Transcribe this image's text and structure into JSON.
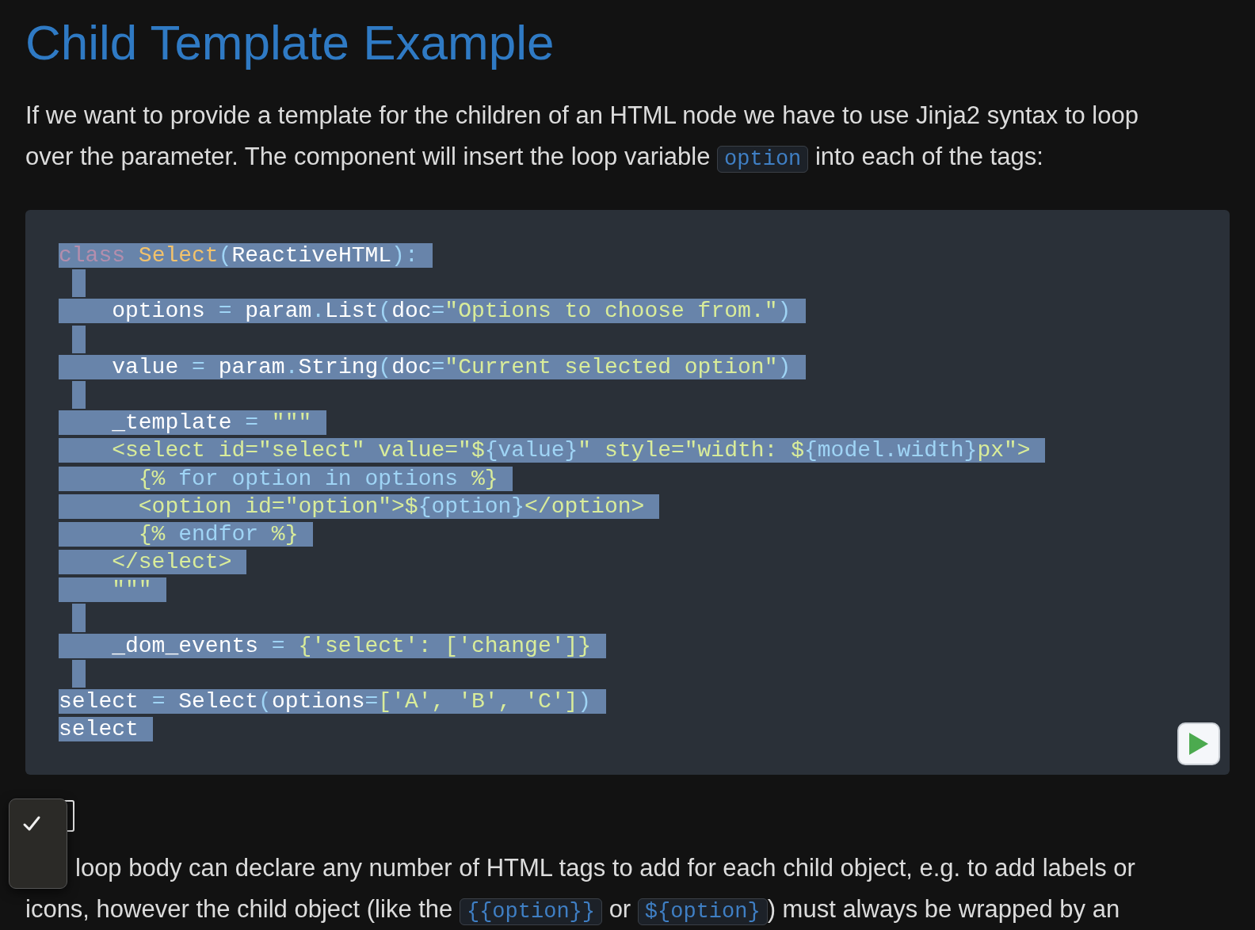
{
  "title": "Child Template Example",
  "intro": {
    "line1": "If we want to provide a template for the children of an HTML node we have to use Jinja2 syntax to loop",
    "before": "over the parameter. The component will insert the loop variable",
    "code": "option",
    "after": "into each of the tags:"
  },
  "code_lines": [
    {
      "kind": "code",
      "tokens": [
        {
          "kind": "keyword",
          "text": "class "
        },
        {
          "kind": "name",
          "text": "Select"
        },
        {
          "kind": "punct",
          "text": "("
        },
        {
          "kind": "plain",
          "text": "ReactiveHTML"
        },
        {
          "kind": "punct",
          "text": "):"
        }
      ]
    },
    {
      "kind": "blank"
    },
    {
      "kind": "code",
      "tokens": [
        {
          "kind": "plain",
          "text": "    options "
        },
        {
          "kind": "punct",
          "text": "="
        },
        {
          "kind": "plain",
          "text": " param"
        },
        {
          "kind": "punct",
          "text": "."
        },
        {
          "kind": "plain",
          "text": "List"
        },
        {
          "kind": "punct",
          "text": "("
        },
        {
          "kind": "plain",
          "text": "doc"
        },
        {
          "kind": "punct",
          "text": "="
        },
        {
          "kind": "string",
          "text": "\"Options to choose from.\""
        },
        {
          "kind": "punct",
          "text": ")"
        }
      ]
    },
    {
      "kind": "blank"
    },
    {
      "kind": "code",
      "tokens": [
        {
          "kind": "plain",
          "text": "    value "
        },
        {
          "kind": "punct",
          "text": "="
        },
        {
          "kind": "plain",
          "text": " param"
        },
        {
          "kind": "punct",
          "text": "."
        },
        {
          "kind": "plain",
          "text": "String"
        },
        {
          "kind": "punct",
          "text": "("
        },
        {
          "kind": "plain",
          "text": "doc"
        },
        {
          "kind": "punct",
          "text": "="
        },
        {
          "kind": "string",
          "text": "\"Current selected option\""
        },
        {
          "kind": "punct",
          "text": ")"
        }
      ]
    },
    {
      "kind": "blank"
    },
    {
      "kind": "code",
      "tokens": [
        {
          "kind": "plain",
          "text": "    _template "
        },
        {
          "kind": "punct",
          "text": "="
        },
        {
          "kind": "string",
          "text": " \"\"\""
        }
      ]
    },
    {
      "kind": "code",
      "tokens": [
        {
          "kind": "string",
          "text": "    <select id=\"select\" value=\"$"
        },
        {
          "kind": "interp",
          "text": "{value}"
        },
        {
          "kind": "string",
          "text": "\" style=\"width: $"
        },
        {
          "kind": "interp",
          "text": "{model.width}"
        },
        {
          "kind": "string",
          "text": "px\">"
        }
      ]
    },
    {
      "kind": "code",
      "tokens": [
        {
          "kind": "string",
          "text": "      {% "
        },
        {
          "kind": "interp",
          "text": "for option in options"
        },
        {
          "kind": "string",
          "text": " %}"
        }
      ]
    },
    {
      "kind": "code",
      "tokens": [
        {
          "kind": "string",
          "text": "      <option id=\"option\">$"
        },
        {
          "kind": "interp",
          "text": "{option}"
        },
        {
          "kind": "string",
          "text": "</option>"
        }
      ]
    },
    {
      "kind": "code",
      "tokens": [
        {
          "kind": "string",
          "text": "      {% "
        },
        {
          "kind": "interp",
          "text": "endfor"
        },
        {
          "kind": "string",
          "text": " %}"
        }
      ]
    },
    {
      "kind": "code",
      "tokens": [
        {
          "kind": "string",
          "text": "    </select>"
        }
      ]
    },
    {
      "kind": "code",
      "tokens": [
        {
          "kind": "string",
          "text": "    \"\"\""
        }
      ]
    },
    {
      "kind": "blank"
    },
    {
      "kind": "code",
      "tokens": [
        {
          "kind": "plain",
          "text": "    _dom_events "
        },
        {
          "kind": "punct",
          "text": "="
        },
        {
          "kind": "string",
          "text": " {'select': ['change']}"
        }
      ]
    },
    {
      "kind": "blank"
    },
    {
      "kind": "code",
      "tokens": [
        {
          "kind": "plain",
          "text": "select "
        },
        {
          "kind": "punct",
          "text": "="
        },
        {
          "kind": "plain",
          "text": " Select"
        },
        {
          "kind": "punct",
          "text": "("
        },
        {
          "kind": "plain",
          "text": "options"
        },
        {
          "kind": "punct",
          "text": "="
        },
        {
          "kind": "string",
          "text": "['A', 'B', 'C']"
        },
        {
          "kind": "punct",
          "text": ")"
        }
      ]
    },
    {
      "kind": "code",
      "tokens": [
        {
          "kind": "plain",
          "text": "select"
        }
      ]
    }
  ],
  "dropdown": {
    "options": [
      {
        "selected": true
      }
    ]
  },
  "outro": {
    "line1": "loop body can declare any number of HTML tags to add for each child object, e.g. to add labels or",
    "line2_before": "icons, however the child object (like the",
    "code1": "{{option}}",
    "middle": "or",
    "code2": "${option}",
    "line2_after": ") must always be wrapped by an"
  }
}
